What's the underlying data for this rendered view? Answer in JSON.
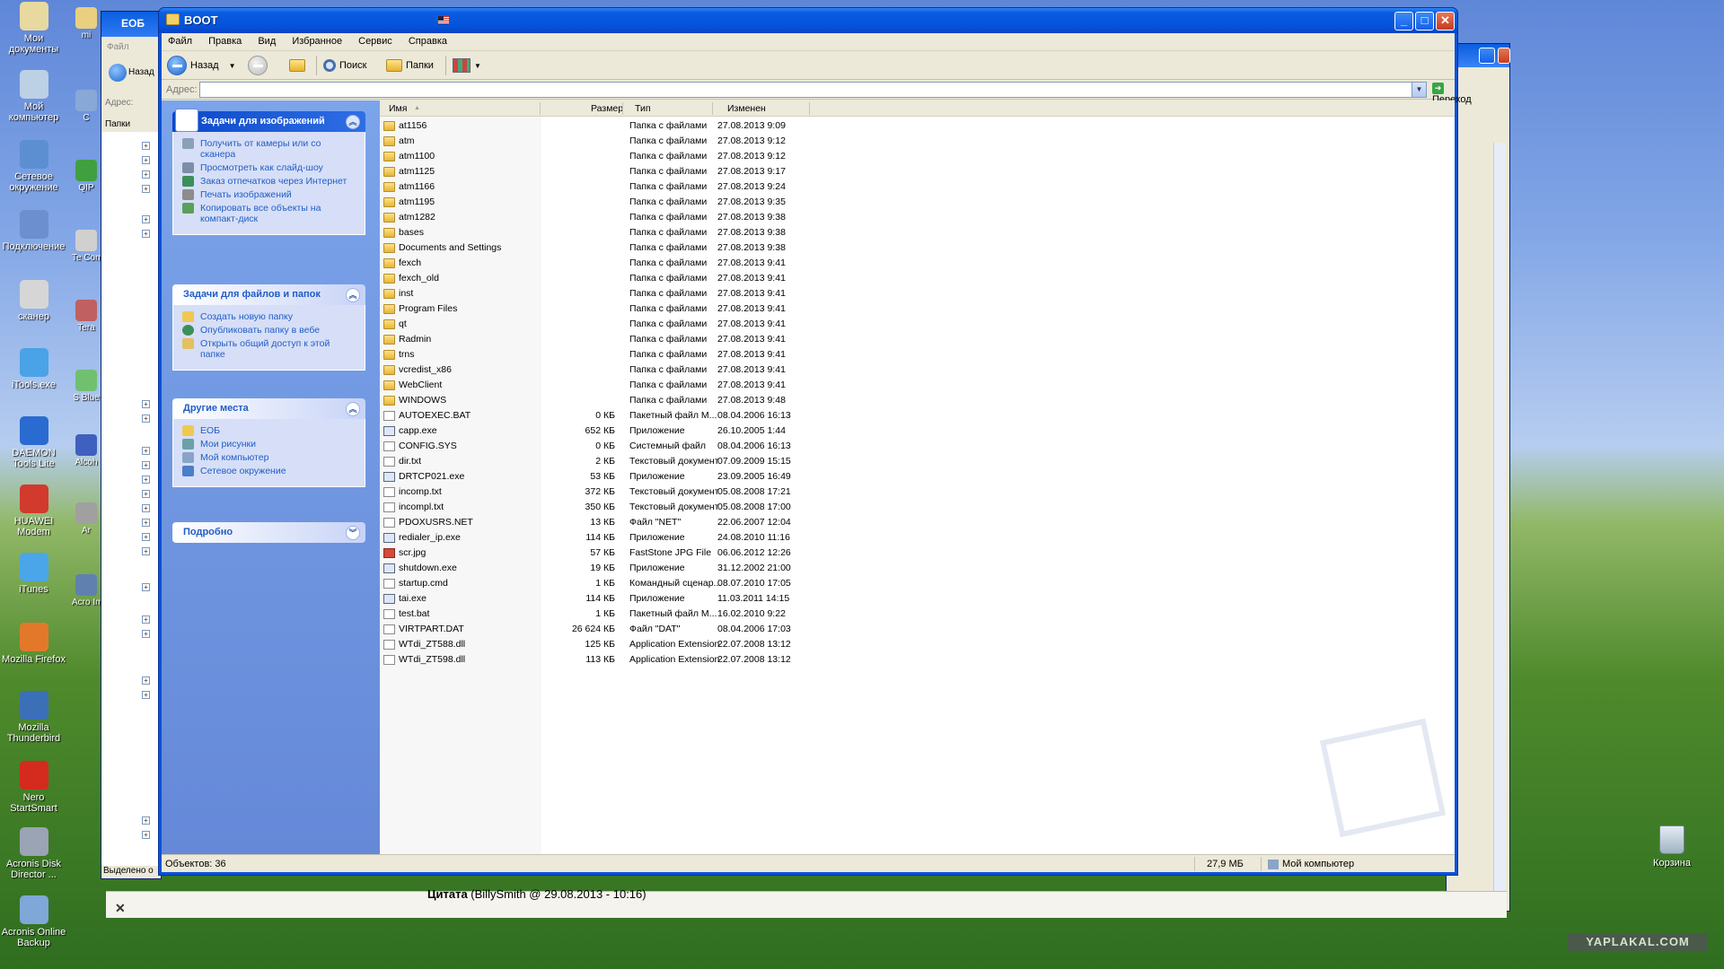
{
  "desktop": {
    "icons": [
      {
        "label": "Мои документы",
        "color": "#e8d9a0"
      },
      {
        "label": "Мой компьютер",
        "color": "#bcd0e6"
      },
      {
        "label": "Сетевое окружение",
        "color": "#5c8fd2"
      },
      {
        "label": "Подключение",
        "color": "#6b8fcf"
      },
      {
        "label": "сканер",
        "color": "#d6d6d6"
      },
      {
        "label": "iTools.exe",
        "color": "#49a3e6"
      },
      {
        "label": "DAEMON Tools Lite",
        "color": "#2a6bd1"
      },
      {
        "label": "HUAWEI Modem",
        "color": "#d23a2e"
      },
      {
        "label": "iTunes",
        "color": "#4aa6e8"
      },
      {
        "label": "Mozilla Firefox",
        "color": "#e4782a"
      },
      {
        "label": "Mozilla Thunderbird",
        "color": "#3b6fb8"
      },
      {
        "label": "Nero StartSmart",
        "color": "#d52a1e"
      },
      {
        "label": "Acronis Disk Director ...",
        "color": "#9aa4b4"
      },
      {
        "label": "Acronis Online Backup",
        "color": "#7fa7d8"
      }
    ],
    "col2": [
      {
        "label": "mi",
        "color": "#e8d080"
      },
      {
        "label": "C",
        "color": "#88a8d8"
      },
      {
        "label": "QIP",
        "color": "#40a040"
      },
      {
        "label": "Te Comr",
        "color": "#d0d0d0"
      },
      {
        "label": "Tera",
        "color": "#c06060"
      },
      {
        "label": "S Blue",
        "color": "#70c070"
      },
      {
        "label": "Alcoh",
        "color": "#4060c0"
      },
      {
        "label": "Ar",
        "color": "#a0a0a0"
      },
      {
        "label": "Acro Imag",
        "color": "#6080b0"
      }
    ],
    "recycle": "Корзина",
    "watermark": "YAPLAKAL.COM",
    "back_window": {
      "title": "ЕОБ",
      "menu_file": "Файл",
      "nav_back": "Назад",
      "address": "Адрес:",
      "folders": "Папки",
      "status": "Выделено о"
    },
    "quote": {
      "bold": "Цитата",
      "rest": " (BillySmith @ 29.08.2013 - 10:16)"
    }
  },
  "window": {
    "title": "BOOT",
    "menu": [
      "Файл",
      "Правка",
      "Вид",
      "Избранное",
      "Сервис",
      "Справка"
    ],
    "toolbar": {
      "back": "Назад",
      "search": "Поиск",
      "folders": "Папки"
    },
    "address_label": "Адрес:",
    "address_value": "",
    "go_label": "Переход",
    "tasks_images": {
      "title": "Задачи для изображений",
      "links": [
        "Получить от камеры или со сканера",
        "Просмотреть как слайд-шоу",
        "Заказ отпечатков через Интернет",
        "Печать изображений",
        "Копировать все объекты на компакт-диск"
      ]
    },
    "tasks_files": {
      "title": "Задачи для файлов и папок",
      "links": [
        "Создать новую папку",
        "Опубликовать папку в вебе",
        "Открыть общий доступ к этой папке"
      ]
    },
    "other_places": {
      "title": "Другие места",
      "links": [
        "ЕОБ",
        "Мои рисунки",
        "Мой компьютер",
        "Сетевое окружение"
      ]
    },
    "details": {
      "title": "Подробно"
    },
    "columns": {
      "name": "Имя",
      "size": "Размер",
      "type": "Тип",
      "modified": "Изменен"
    },
    "files": [
      {
        "name": "at1156",
        "size": "",
        "type": "Папка с файлами",
        "date": "27.08.2013 9:09",
        "kind": "folder"
      },
      {
        "name": "atm",
        "size": "",
        "type": "Папка с файлами",
        "date": "27.08.2013 9:12",
        "kind": "folder"
      },
      {
        "name": "atm1100",
        "size": "",
        "type": "Папка с файлами",
        "date": "27.08.2013 9:12",
        "kind": "folder"
      },
      {
        "name": "atm1125",
        "size": "",
        "type": "Папка с файлами",
        "date": "27.08.2013 9:17",
        "kind": "folder"
      },
      {
        "name": "atm1166",
        "size": "",
        "type": "Папка с файлами",
        "date": "27.08.2013 9:24",
        "kind": "folder"
      },
      {
        "name": "atm1195",
        "size": "",
        "type": "Папка с файлами",
        "date": "27.08.2013 9:35",
        "kind": "folder"
      },
      {
        "name": "atm1282",
        "size": "",
        "type": "Папка с файлами",
        "date": "27.08.2013 9:38",
        "kind": "folder"
      },
      {
        "name": "bases",
        "size": "",
        "type": "Папка с файлами",
        "date": "27.08.2013 9:38",
        "kind": "folder"
      },
      {
        "name": "Documents and Settings",
        "size": "",
        "type": "Папка с файлами",
        "date": "27.08.2013 9:38",
        "kind": "folder"
      },
      {
        "name": "fexch",
        "size": "",
        "type": "Папка с файлами",
        "date": "27.08.2013 9:41",
        "kind": "folder"
      },
      {
        "name": "fexch_old",
        "size": "",
        "type": "Папка с файлами",
        "date": "27.08.2013 9:41",
        "kind": "folder"
      },
      {
        "name": "inst",
        "size": "",
        "type": "Папка с файлами",
        "date": "27.08.2013 9:41",
        "kind": "folder"
      },
      {
        "name": "Program Files",
        "size": "",
        "type": "Папка с файлами",
        "date": "27.08.2013 9:41",
        "kind": "folder"
      },
      {
        "name": "qt",
        "size": "",
        "type": "Папка с файлами",
        "date": "27.08.2013 9:41",
        "kind": "folder"
      },
      {
        "name": "Radmin",
        "size": "",
        "type": "Папка с файлами",
        "date": "27.08.2013 9:41",
        "kind": "folder"
      },
      {
        "name": "trns",
        "size": "",
        "type": "Папка с файлами",
        "date": "27.08.2013 9:41",
        "kind": "folder"
      },
      {
        "name": "vcredist_x86",
        "size": "",
        "type": "Папка с файлами",
        "date": "27.08.2013 9:41",
        "kind": "folder"
      },
      {
        "name": "WebClient",
        "size": "",
        "type": "Папка с файлами",
        "date": "27.08.2013 9:41",
        "kind": "folder"
      },
      {
        "name": "WINDOWS",
        "size": "",
        "type": "Папка с файлами",
        "date": "27.08.2013 9:48",
        "kind": "folder"
      },
      {
        "name": "AUTOEXEC.BAT",
        "size": "0 КБ",
        "type": "Пакетный файл M...",
        "date": "08.04.2006 16:13",
        "kind": "file"
      },
      {
        "name": "capp.exe",
        "size": "652 КБ",
        "type": "Приложение",
        "date": "26.10.2005 1:44",
        "kind": "exe"
      },
      {
        "name": "CONFIG.SYS",
        "size": "0 КБ",
        "type": "Системный файл",
        "date": "08.04.2006 16:13",
        "kind": "file"
      },
      {
        "name": "dir.txt",
        "size": "2 КБ",
        "type": "Текстовый документ",
        "date": "07.09.2009 15:15",
        "kind": "file"
      },
      {
        "name": "DRTCP021.exe",
        "size": "53 КБ",
        "type": "Приложение",
        "date": "23.09.2005 16:49",
        "kind": "exe"
      },
      {
        "name": "incomp.txt",
        "size": "372 КБ",
        "type": "Текстовый документ",
        "date": "05.08.2008 17:21",
        "kind": "file"
      },
      {
        "name": "incompl.txt",
        "size": "350 КБ",
        "type": "Текстовый документ",
        "date": "05.08.2008 17:00",
        "kind": "file"
      },
      {
        "name": "PDOXUSRS.NET",
        "size": "13 КБ",
        "type": "Файл \"NET\"",
        "date": "22.06.2007 12:04",
        "kind": "file"
      },
      {
        "name": "redialer_ip.exe",
        "size": "114 КБ",
        "type": "Приложение",
        "date": "24.08.2010 11:16",
        "kind": "exe"
      },
      {
        "name": "scr.jpg",
        "size": "57 КБ",
        "type": "FastStone JPG File",
        "date": "06.06.2012 12:26",
        "kind": "img"
      },
      {
        "name": "shutdown.exe",
        "size": "19 КБ",
        "type": "Приложение",
        "date": "31.12.2002 21:00",
        "kind": "exe"
      },
      {
        "name": "startup.cmd",
        "size": "1 КБ",
        "type": "Командный сценар...",
        "date": "08.07.2010 17:05",
        "kind": "file"
      },
      {
        "name": "tai.exe",
        "size": "114 КБ",
        "type": "Приложение",
        "date": "11.03.2011 14:15",
        "kind": "exe"
      },
      {
        "name": "test.bat",
        "size": "1 КБ",
        "type": "Пакетный файл M...",
        "date": "16.02.2010 9:22",
        "kind": "file"
      },
      {
        "name": "VIRTPART.DAT",
        "size": "26 624 КБ",
        "type": "Файл \"DAT\"",
        "date": "08.04.2006 17:03",
        "kind": "file"
      },
      {
        "name": "WTdi_ZT588.dll",
        "size": "125 КБ",
        "type": "Application Extension",
        "date": "22.07.2008 13:12",
        "kind": "file"
      },
      {
        "name": "WTdi_ZT598.dll",
        "size": "113 КБ",
        "type": "Application Extension",
        "date": "22.07.2008 13:12",
        "kind": "file"
      }
    ],
    "status": {
      "objects": "Объектов: 36",
      "size": "27,9 МБ",
      "location": "Мой компьютер"
    }
  }
}
